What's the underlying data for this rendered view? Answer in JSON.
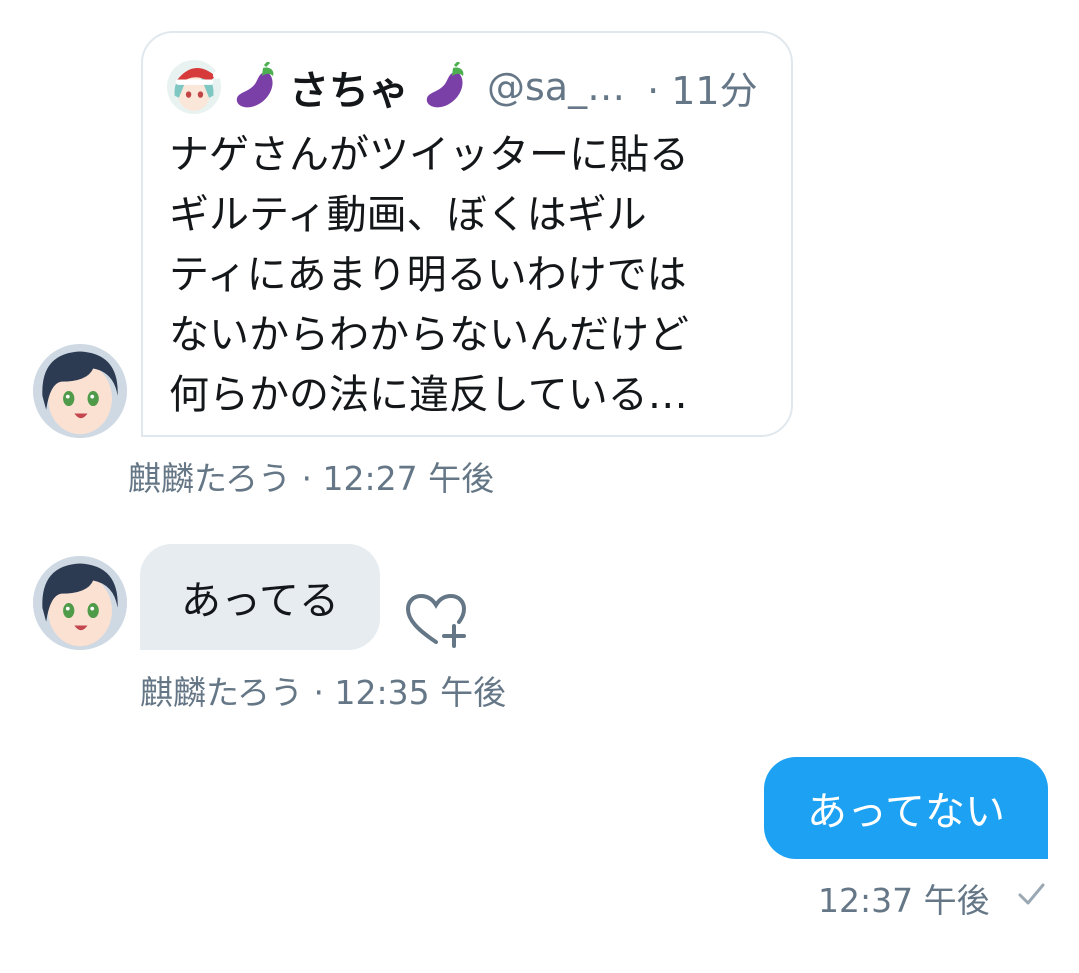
{
  "messages": [
    {
      "quote": {
        "name": "さちゃ",
        "handle": "@sa_…",
        "time": "· 11分",
        "lines": [
          "ナゲさんがツイッターに貼る",
          "ギルティ動画、ぼくはギル",
          "ティにあまり明るいわけでは",
          "ないからわからないんだけど",
          "何らかの法に違反している…"
        ]
      },
      "sender": "麒麟たろう",
      "timestamp": "· 12:27 午後"
    },
    {
      "text": "あってる",
      "sender": "麒麟たろう",
      "timestamp": "· 12:35 午後"
    },
    {
      "text": "あってない",
      "timestamp": "12:37 午後"
    }
  ],
  "icons": {
    "quote_avatar": "santa-hat-avatar",
    "name_prefix": "eggplant-emoji",
    "name_suffix": "eggplant-emoji",
    "reaction": "heart-plus-icon",
    "status": "check-icon"
  },
  "colors": {
    "accent": "#1da1f2",
    "incoming_bubble": "#e6ecf0",
    "meta_text": "#657786"
  }
}
